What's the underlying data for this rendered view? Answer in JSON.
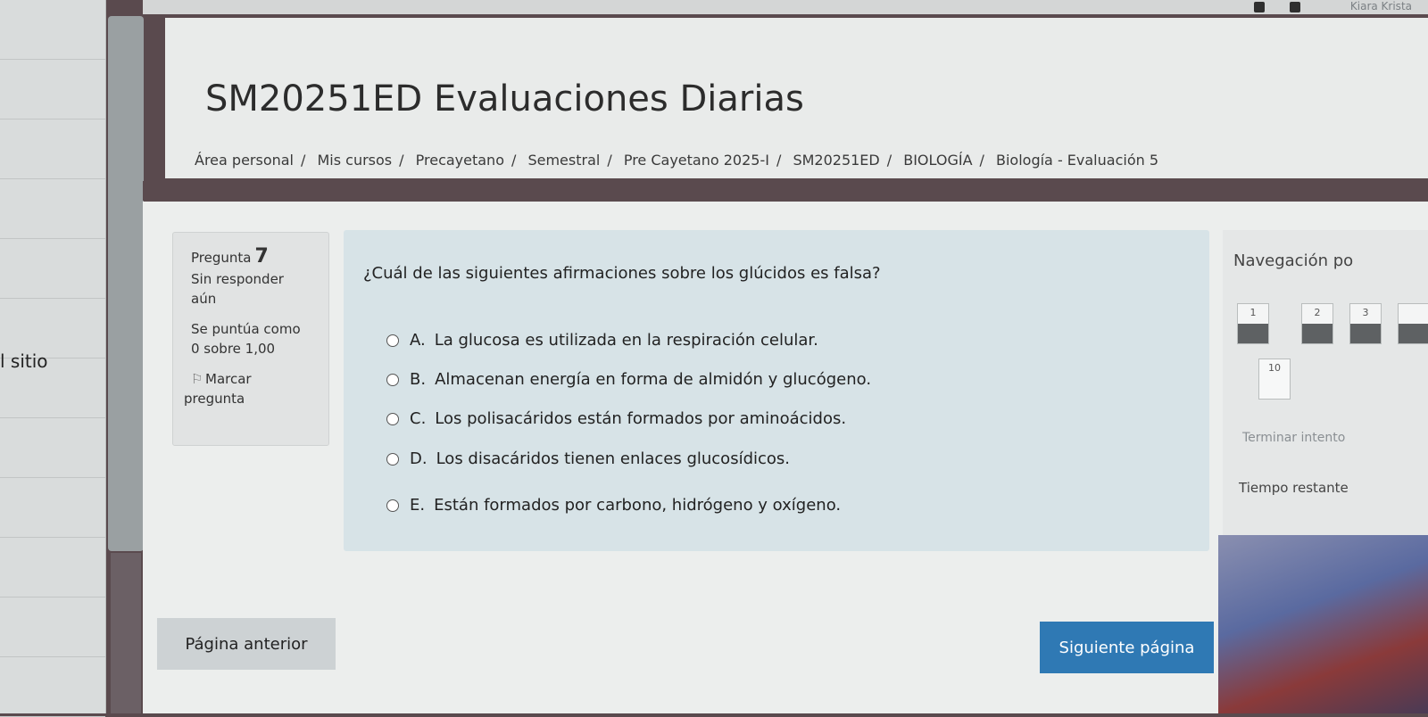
{
  "topbar": {
    "user_name": "Kiara Krista"
  },
  "sidebar": {
    "label": "l sitio"
  },
  "header": {
    "title": "SM20251ED Evaluaciones Diarias",
    "breadcrumb": [
      "Área personal",
      "Mis cursos",
      "Precayetano",
      "Semestral",
      "Pre Cayetano 2025-I",
      "SM20251ED",
      "BIOLOGÍA",
      "Biología - Evaluación 5"
    ]
  },
  "question_info": {
    "label": "Pregunta",
    "number": "7",
    "status_line1": "Sin responder",
    "status_line2": "aún",
    "score_line1": "Se puntúa como",
    "score_line2": "0 sobre 1,00",
    "flag_line1": "Marcar",
    "flag_line2": "pregunta"
  },
  "question": {
    "text": "¿Cuál de las siguientes afirmaciones sobre los glúcidos es falsa?",
    "options": [
      {
        "letter": "A.",
        "text": "La glucosa es utilizada en la respiración celular."
      },
      {
        "letter": "B.",
        "text": "Almacenan energía en forma de almidón y glucógeno."
      },
      {
        "letter": "C.",
        "text": "Los polisacáridos están formados por aminoácidos."
      },
      {
        "letter": "D.",
        "text": "Los disacáridos tienen enlaces glucosídicos."
      },
      {
        "letter": "E.",
        "text": "Están formados por carbono, hidrógeno y oxígeno."
      }
    ]
  },
  "navigation": {
    "title": "Navegación po",
    "boxes": [
      "1",
      "2",
      "3",
      "10"
    ],
    "finish_label": "Terminar intento",
    "time_label": "Tiempo restante"
  },
  "buttons": {
    "prev": "Página anterior",
    "next": "Siguiente página"
  }
}
